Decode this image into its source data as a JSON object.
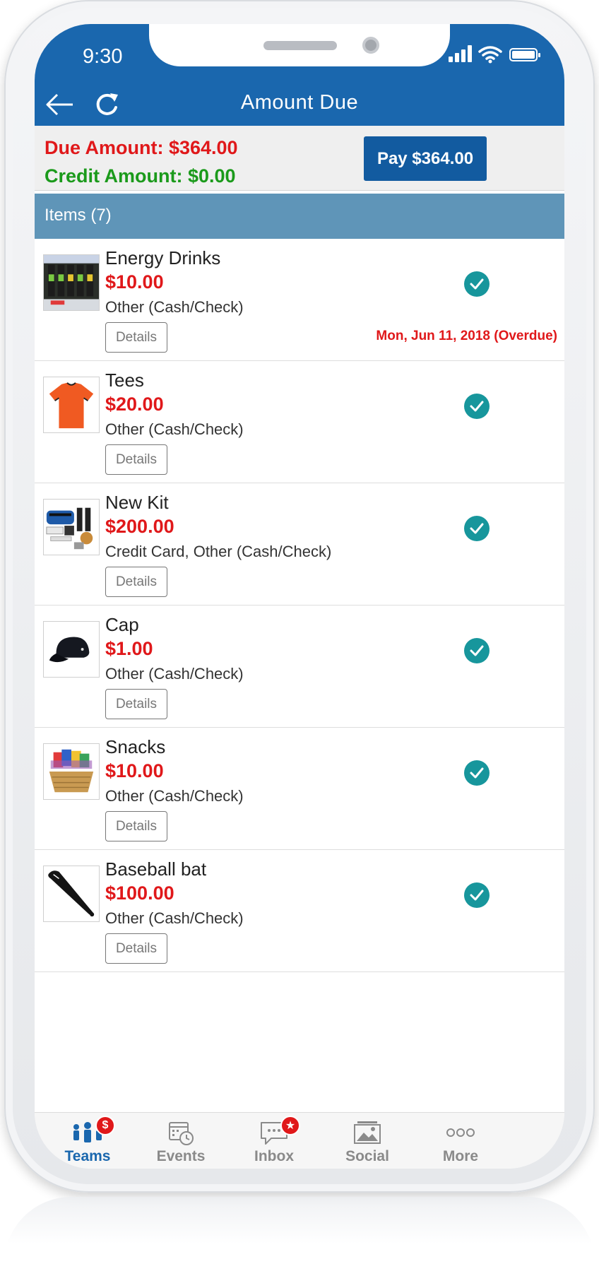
{
  "status_bar": {
    "time": "9:30"
  },
  "header": {
    "title": "Amount Due"
  },
  "summary": {
    "due": "Due Amount: $364.00",
    "credit": "Credit Amount: $0.00",
    "pay_button": "Pay $364.00"
  },
  "items_header": "Items (7)",
  "items": [
    {
      "name": "Energy Drinks",
      "price": "$10.00",
      "method": "Other (Cash/Check)",
      "details": "Details",
      "due_note": "Mon, Jun 11, 2018 (Overdue)",
      "image": "energy-drinks-image"
    },
    {
      "name": "Tees",
      "price": "$20.00",
      "method": "Other (Cash/Check)",
      "details": "Details",
      "image": "tee-shirt-image"
    },
    {
      "name": "New Kit",
      "price": "$200.00",
      "method": "Credit Card, Other (Cash/Check)",
      "details": "Details",
      "image": "kit-image"
    },
    {
      "name": "Cap",
      "price": "$1.00",
      "method": "Other (Cash/Check)",
      "details": "Details",
      "image": "cap-image"
    },
    {
      "name": "Snacks",
      "price": "$10.00",
      "method": "Other (Cash/Check)",
      "details": "Details",
      "image": "snacks-image"
    },
    {
      "name": "Baseball bat",
      "price": "$100.00",
      "method": "Other (Cash/Check)",
      "details": "Details",
      "image": "baseball-bat-image"
    }
  ],
  "tabbar": {
    "teams": {
      "label": "Teams",
      "badge": "$"
    },
    "events": {
      "label": "Events"
    },
    "inbox": {
      "label": "Inbox",
      "badge": "★"
    },
    "social": {
      "label": "Social"
    },
    "more": {
      "label": "More"
    }
  },
  "colors": {
    "header_blue": "#1a67ae",
    "pay_button": "#125ba0",
    "items_header": "#5f95b8",
    "due_red": "#e0181a",
    "credit_green": "#1b9a1b",
    "check_teal": "#17969c"
  }
}
